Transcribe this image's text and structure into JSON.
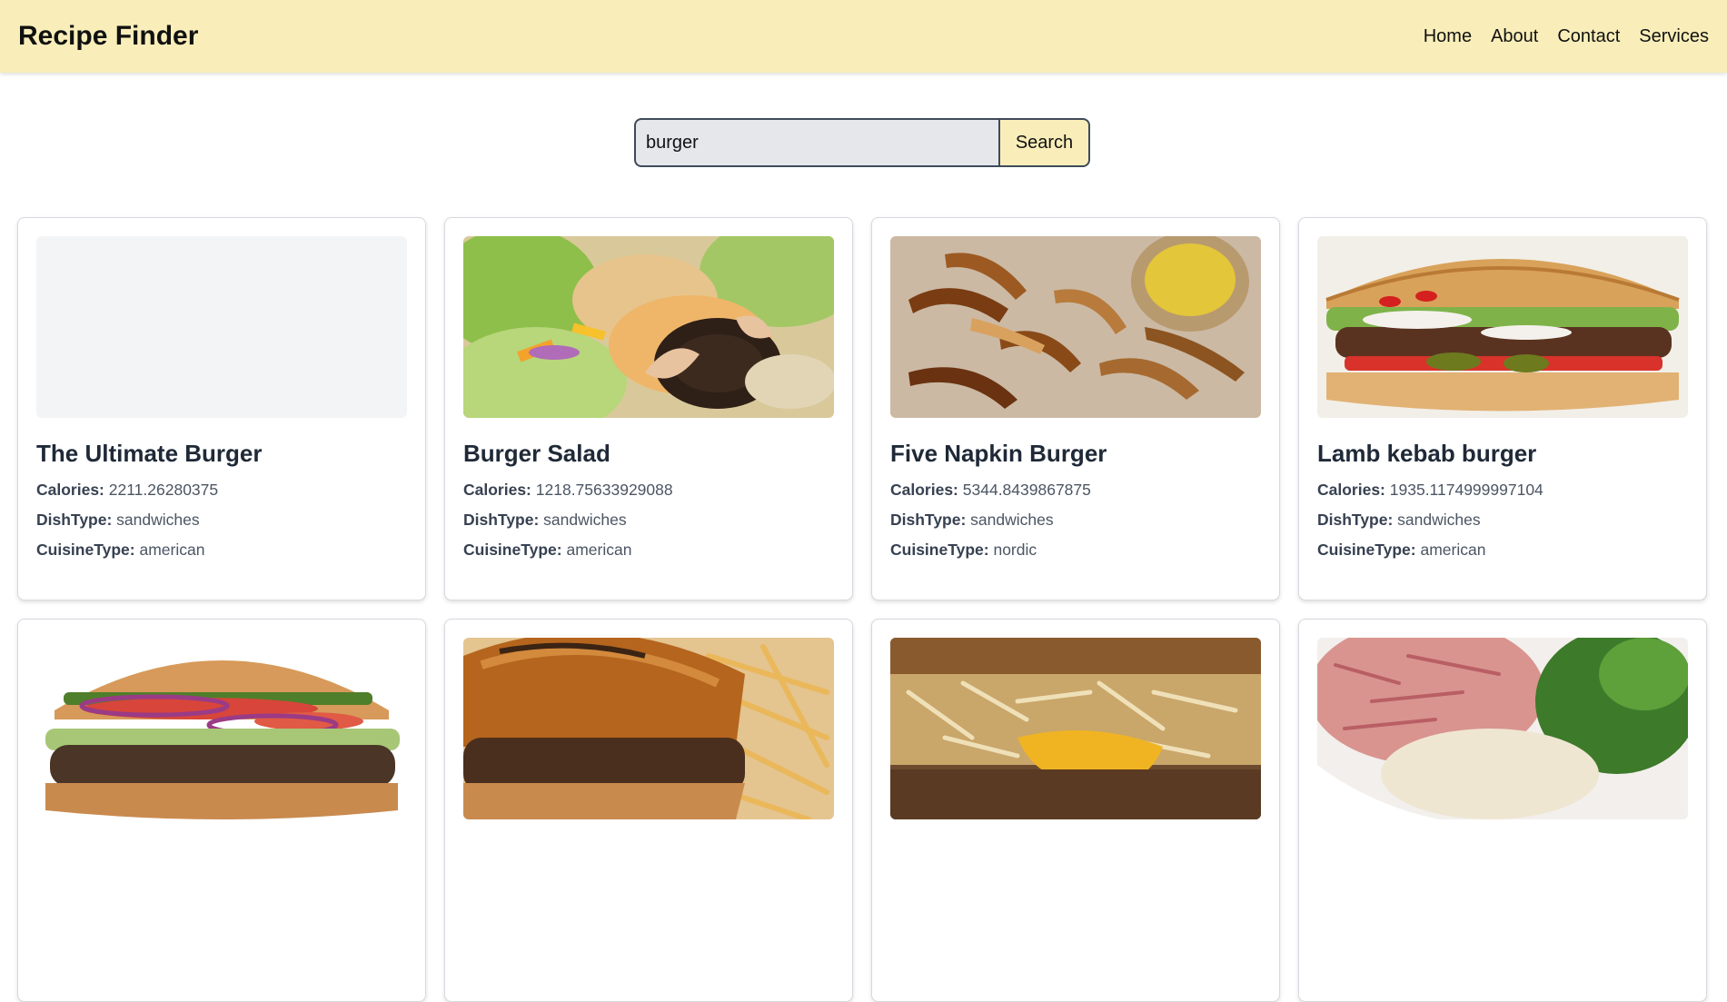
{
  "header": {
    "brand": "Recipe Finder",
    "nav": [
      "Home",
      "About",
      "Contact",
      "Services"
    ]
  },
  "search": {
    "value": "burger",
    "button_label": "Search"
  },
  "labels": {
    "calories": "Calories:",
    "dish_type": "DishType:",
    "cuisine_type": "CuisineType:"
  },
  "colors": {
    "header_bg": "#f9eeb9",
    "search_button_bg": "#f9eeb9",
    "search_input_bg": "#e5e7eb"
  },
  "recipes": [
    {
      "title": "The Ultimate Burger",
      "calories": "2211.26280375",
      "dish_type": "sandwiches",
      "cuisine_type": "american",
      "image": "placeholder"
    },
    {
      "title": "Burger Salad",
      "calories": "1218.75633929088",
      "dish_type": "sandwiches",
      "cuisine_type": "american",
      "image": "burger-salad-photo"
    },
    {
      "title": "Five Napkin Burger",
      "calories": "5344.8439867875",
      "dish_type": "sandwiches",
      "cuisine_type": "nordic",
      "image": "fries-photo"
    },
    {
      "title": "Lamb kebab burger",
      "calories": "1935.1174999997104",
      "dish_type": "sandwiches",
      "cuisine_type": "american",
      "image": "lamb-burger-photo"
    },
    {
      "title": "",
      "calories": "",
      "dish_type": "",
      "cuisine_type": "",
      "image": "classic-burger-photo"
    },
    {
      "title": "",
      "calories": "",
      "dish_type": "",
      "cuisine_type": "",
      "image": "burger-fries-photo"
    },
    {
      "title": "",
      "calories": "",
      "dish_type": "",
      "cuisine_type": "",
      "image": "hashbrown-burger-photo"
    },
    {
      "title": "",
      "calories": "",
      "dish_type": "",
      "cuisine_type": "",
      "image": "ground-meat-photo"
    }
  ]
}
